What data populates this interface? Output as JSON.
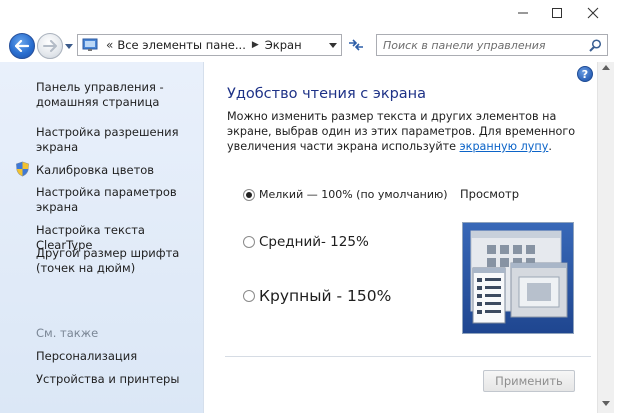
{
  "nav": {
    "breadcrumb_sep": "«",
    "breadcrumb_1": "Все элементы пане...",
    "breadcrumb_arrow": "▶",
    "breadcrumb_2": "Экран",
    "search_placeholder": "Поиск в панели управления"
  },
  "sidebar": {
    "items": [
      {
        "label": "Панель управления -\nдомашняя страница"
      },
      {
        "label": "Настройка разрешения\nэкрана"
      },
      {
        "label": "Калибровка цветов",
        "icon": "shield-icon"
      },
      {
        "label": "Настройка параметров\nэкрана"
      },
      {
        "label": "Настройка текста ClearType"
      },
      {
        "label": "Другой размер шрифта\n(точек на дюйм)"
      }
    ],
    "see_also_title": "См. также",
    "see_also": [
      {
        "label": "Персонализация"
      },
      {
        "label": "Устройства и принтеры"
      }
    ]
  },
  "main": {
    "heading": "Удобство чтения с экрана",
    "desc_text": "Можно изменить размер текста и других элементов на экране, выбрав один из этих параметров. Для временного увеличения части экрана используйте ",
    "desc_link": "экранную лупу",
    "desc_end": ".",
    "options": [
      {
        "label": "Мелкий — 100% (по умолчанию)",
        "checked": true
      },
      {
        "label": "Средний- 125%",
        "checked": false
      },
      {
        "label": "Крупный - 150%",
        "checked": false
      }
    ],
    "preview_label": "Просмотр",
    "apply_label": "Применить",
    "help_glyph": "?"
  },
  "colors": {
    "heading": "#1e3287",
    "link": "#0c64c8",
    "sidebar_bg": "#e2ebf8"
  }
}
